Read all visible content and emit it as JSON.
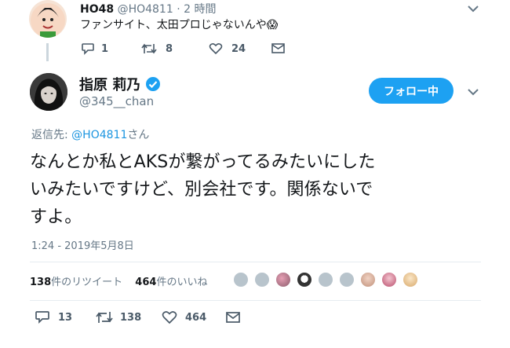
{
  "reply_tweet": {
    "author_name": "HO48",
    "handle": "@HO4811",
    "separator": "·",
    "time": "2 時間",
    "text": "ファンサイト、太田プロじゃないんや😱",
    "reply_count": "1",
    "retweet_count": "8",
    "like_count": "24"
  },
  "main_tweet": {
    "author_name": "指原 莉乃",
    "handle": "@345__chan",
    "follow_label": "フォロー中",
    "reply_to_prefix": "返信先: ",
    "reply_to_handle": "@HO4811",
    "reply_to_suffix": "さん",
    "text_line1": "なんとか私とAKSが繋がってるみたいにした",
    "text_line2": "いみたいですけど、別会社です。関係ないで",
    "text_line3": "すよ。",
    "timestamp": "1:24 - 2019年5月8日",
    "retweet_stat_num": "138",
    "retweet_stat_label": "件のリツイート",
    "like_stat_num": "464",
    "like_stat_label": "件のいいね",
    "reply_count": "13",
    "retweet_count": "138",
    "like_count": "464"
  },
  "colors": {
    "accent": "#1da1f2",
    "verified": "#1da1f2",
    "muted": "#657786",
    "link": "#1b95e0"
  },
  "icons": [
    "avatar-ho48",
    "chevron-down-icon",
    "reply-icon",
    "retweet-icon",
    "heart-icon",
    "mail-icon",
    "verified-badge-icon"
  ]
}
